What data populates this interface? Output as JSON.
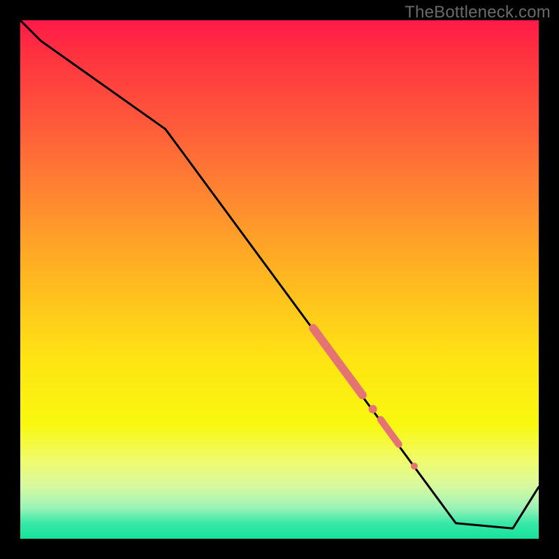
{
  "watermark": "TheBottleneck.com",
  "colors": {
    "border": "#000000",
    "curve": "#000000",
    "highlight_fill": "#e57373",
    "highlight_stroke": "#d86a6a"
  },
  "chart_data": {
    "type": "line",
    "title": "",
    "xlabel": "",
    "ylabel": "",
    "xlim": [
      0,
      100
    ],
    "ylim": [
      0,
      100
    ],
    "x": [
      0,
      4,
      28,
      84,
      95,
      100
    ],
    "values": [
      100,
      96,
      79,
      3,
      2,
      10
    ],
    "highlights": [
      {
        "kind": "segment",
        "x0": 56.5,
        "y0": 40.6,
        "x1": 66.0,
        "y1": 27.7,
        "thickness": 12
      },
      {
        "kind": "dot",
        "x": 68.0,
        "y": 25.0,
        "r": 6
      },
      {
        "kind": "segment",
        "x0": 69.5,
        "y0": 23.0,
        "x1": 73.0,
        "y1": 18.2,
        "thickness": 10
      },
      {
        "kind": "dot",
        "x": 76.0,
        "y": 14.0,
        "r": 5
      }
    ]
  }
}
